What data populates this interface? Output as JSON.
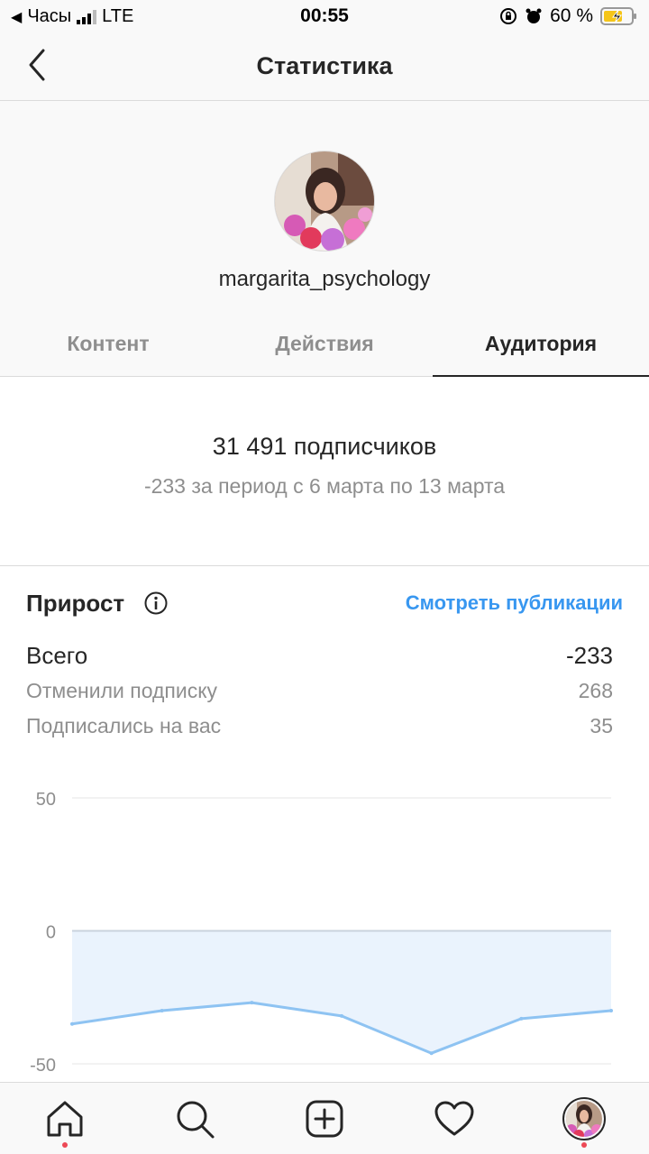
{
  "status_bar": {
    "back_app": "Часы",
    "network": "LTE",
    "time": "00:55",
    "battery": "60 %"
  },
  "header": {
    "title": "Статистика"
  },
  "profile": {
    "username": "margarita_psychology"
  },
  "tabs": [
    {
      "label": "Контент",
      "active": false
    },
    {
      "label": "Действия",
      "active": false
    },
    {
      "label": "Аудитория",
      "active": true
    }
  ],
  "summary": {
    "followers": "31 491 подписчиков",
    "period": "-233 за период с 6 марта по 13 марта"
  },
  "growth": {
    "title": "Прирост",
    "view_link": "Смотреть публикации",
    "rows": [
      {
        "label": "Всего",
        "value": "-233"
      },
      {
        "label": "Отменили подписку",
        "value": "268"
      },
      {
        "label": "Подписались на вас",
        "value": "35"
      }
    ]
  },
  "chart_data": {
    "type": "area",
    "x": [
      1,
      2,
      3,
      4,
      5,
      6,
      7
    ],
    "values": [
      -35,
      -30,
      -27,
      -32,
      -46,
      -33,
      -30
    ],
    "ylim": [
      -50,
      50
    ],
    "yticks": [
      "50",
      "0",
      "-50"
    ],
    "grid": true,
    "line_color": "#8ec3f2",
    "fill_color": "#eaf3fd"
  },
  "colors": {
    "accent": "#3897f0",
    "notification": "#ed4956"
  },
  "bottom_nav": [
    "home-icon",
    "search-icon",
    "add-post-icon",
    "heart-icon",
    "profile-avatar"
  ]
}
